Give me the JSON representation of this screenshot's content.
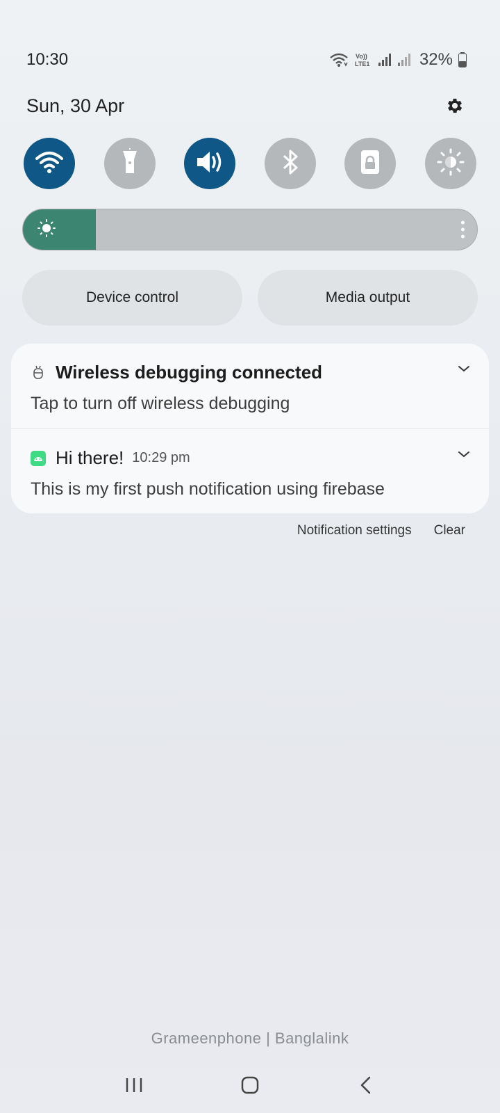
{
  "status_bar": {
    "time": "10:30",
    "battery": "32%",
    "icons": [
      "wifi-icon",
      "volte-icon",
      "signal-icon",
      "signal-icon",
      "battery-icon"
    ]
  },
  "header": {
    "date": "Sun, 30 Apr",
    "settings_icon": "gear-icon"
  },
  "quick_toggles": [
    {
      "icon": "wifi-icon",
      "state": "on"
    },
    {
      "icon": "flashlight-icon",
      "state": "off"
    },
    {
      "icon": "sound-icon",
      "state": "on"
    },
    {
      "icon": "bluetooth-icon",
      "state": "off"
    },
    {
      "icon": "lock-icon",
      "state": "off"
    },
    {
      "icon": "brightness-icon",
      "state": "off"
    }
  ],
  "brightness": {
    "level": 0.16,
    "icon": "sun-icon"
  },
  "controls": {
    "device_control": "Device control",
    "media_output": "Media output"
  },
  "notifications": [
    {
      "icon": "debug-icon",
      "title": "Wireless debugging connected",
      "time": "",
      "body": "Tap to turn off wireless debugging"
    },
    {
      "icon": "android-icon",
      "title": "Hi there!",
      "time": "10:29 pm",
      "body": "This is my first push notification using firebase"
    }
  ],
  "actions": {
    "settings": "Notification settings",
    "clear": "Clear"
  },
  "carrier": "Grameenphone | Banglalink",
  "colors": {
    "toggle_on": "#0f5787",
    "toggle_off": "#b5b8ba",
    "brightness_fill": "#3c8570",
    "android_green": "#3ddc84"
  }
}
